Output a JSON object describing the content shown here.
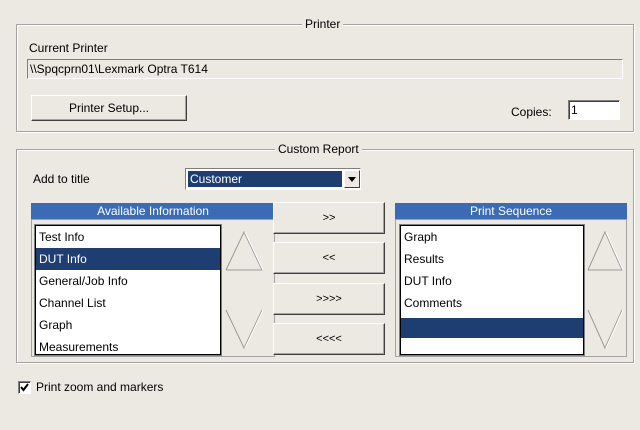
{
  "printer_group": {
    "title": "Printer",
    "current_printer_label": "Current Printer",
    "current_printer_value": "\\\\Spqcprn01\\Lexmark Optra T614",
    "setup_button": "Printer Setup...",
    "copies_label": "Copies:",
    "copies_value": "1"
  },
  "report_group": {
    "title": "Custom Report",
    "add_to_title_label": "Add to title",
    "add_to_title_value": "Customer",
    "available": {
      "header": "Available Information",
      "items": [
        "Test Info",
        "DUT Info",
        "General/Job Info",
        "Channel List",
        "Graph",
        "Measurements"
      ],
      "selected_index": 1
    },
    "sequence": {
      "header": "Print Sequence",
      "items": [
        "Graph",
        "Results",
        "DUT Info",
        "Comments",
        ""
      ],
      "selected_index": 4
    },
    "buttons": {
      "add": ">>",
      "remove": "<<",
      "add_all": ">>>>",
      "remove_all": "<<<<"
    }
  },
  "zoom_checkbox": {
    "label": "Print zoom and markers",
    "checked": true
  }
}
